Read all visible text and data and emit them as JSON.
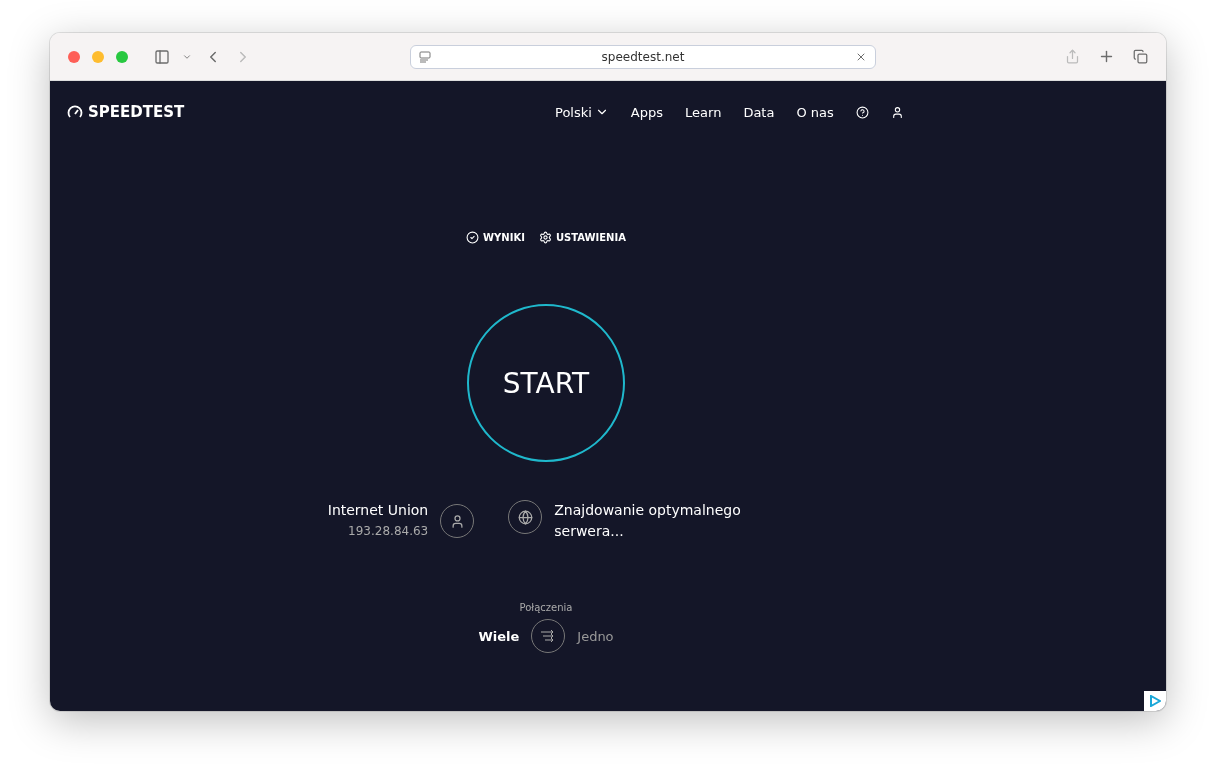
{
  "browser": {
    "url": "speedtest.net"
  },
  "site": {
    "logo": "SPEEDTEST",
    "nav": [
      {
        "label": "Polski",
        "kind": "dropdown"
      },
      {
        "label": "Apps",
        "kind": "link"
      },
      {
        "label": "Learn",
        "kind": "link"
      },
      {
        "label": "Data",
        "kind": "link"
      },
      {
        "label": "O nas",
        "kind": "link"
      },
      {
        "kind": "help"
      },
      {
        "kind": "account"
      }
    ]
  },
  "links": [
    {
      "label": "WYNIKI",
      "kind": "results"
    },
    {
      "label": "USTAWIENIA",
      "kind": "settings"
    }
  ],
  "start_button": "START",
  "provider": {
    "name": "Internet Union",
    "ip": "193.28.84.63"
  },
  "server": {
    "status": "Znajdowanie optymalnego serwera..."
  },
  "connections": {
    "label": "Połączenia",
    "options": [
      {
        "label": "Wiele",
        "selected": true
      },
      {
        "label": "Jedno",
        "selected": false
      }
    ]
  }
}
